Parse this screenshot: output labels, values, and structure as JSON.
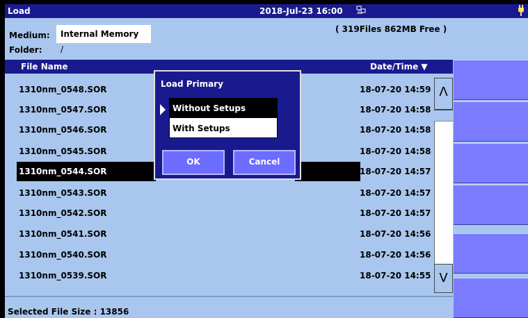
{
  "titlebar": {
    "title": "Load",
    "datetime": "2018-Jul-23 16:00",
    "network_icon": "network-icon",
    "battery_icon": "battery-plug-icon"
  },
  "header": {
    "medium_label": "Medium:",
    "medium_value": "Internal Memory",
    "folder_label": "Folder:",
    "folder_value": "/",
    "files_free": "( 319Files  862MB Free )"
  },
  "list": {
    "col_name": "File Name",
    "col_date": "Date/Time ▼",
    "rows": [
      {
        "name": "1310nm_0548.SOR",
        "date": "18-07-20 14:59"
      },
      {
        "name": "1310nm_0547.SOR",
        "date": "18-07-20 14:58"
      },
      {
        "name": "1310nm_0546.SOR",
        "date": "18-07-20 14:58"
      },
      {
        "name": "1310nm_0545.SOR",
        "date": "18-07-20 14:58"
      },
      {
        "name": "1310nm_0544.SOR",
        "date": "18-07-20 14:57"
      },
      {
        "name": "1310nm_0543.SOR",
        "date": "18-07-20 14:57"
      },
      {
        "name": "1310nm_0542.SOR",
        "date": "18-07-20 14:57"
      },
      {
        "name": "1310nm_0541.SOR",
        "date": "18-07-20 14:56"
      },
      {
        "name": "1310nm_0540.SOR",
        "date": "18-07-20 14:56"
      },
      {
        "name": "1310nm_0539.SOR",
        "date": "18-07-20 14:55"
      }
    ],
    "selected_index": 4,
    "scroll_up": "Λ",
    "scroll_down": "V"
  },
  "status": {
    "text": "Selected File Size : 13856"
  },
  "dialog": {
    "title": "Load Primary",
    "options": [
      "Without Setups",
      "With Setups"
    ],
    "selected_option": 0,
    "ok": "OK",
    "cancel": "Cancel"
  },
  "colors": {
    "background": "#a9c7ee",
    "titlebar": "#1a1a8f",
    "side_button": "#7b7bff",
    "dialog_button": "#6c6cff"
  }
}
